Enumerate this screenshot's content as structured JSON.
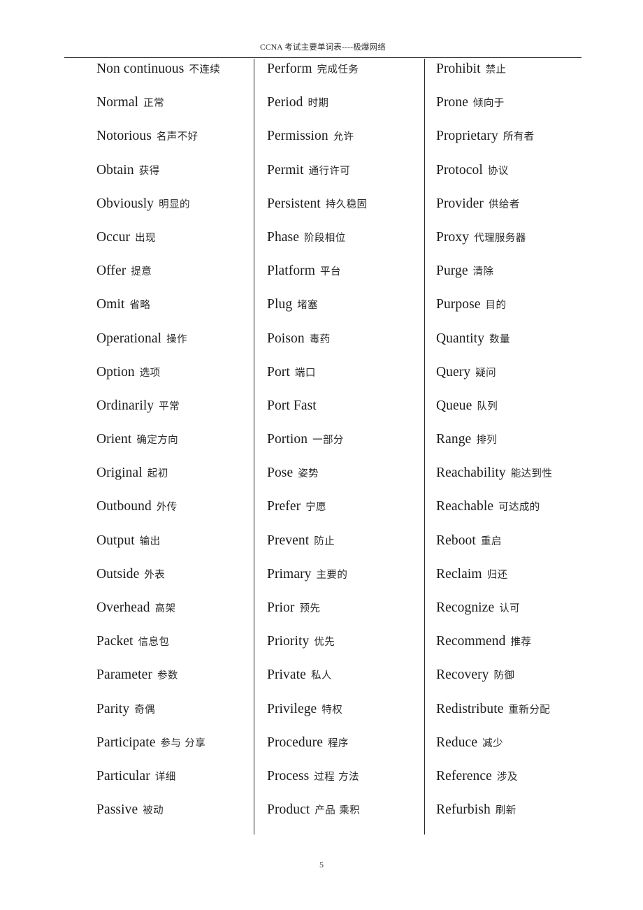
{
  "header": {
    "running_title": "CCNA 考试主要单词表----极爆网络"
  },
  "footer": {
    "page_number": "5"
  },
  "columns": [
    {
      "entries": [
        {
          "term": "Non continuous",
          "gloss": "不连续"
        },
        {
          "term": "Normal",
          "gloss": "正常"
        },
        {
          "term": "Notorious",
          "gloss": "名声不好"
        },
        {
          "term": "Obtain",
          "gloss": "获得"
        },
        {
          "term": "Obviously",
          "gloss": "明显的"
        },
        {
          "term": "Occur",
          "gloss": "出现"
        },
        {
          "term": "Offer",
          "gloss": "提意"
        },
        {
          "term": "Omit",
          "gloss": "省略"
        },
        {
          "term": "Operational",
          "gloss": "操作"
        },
        {
          "term": "Option",
          "gloss": "选项"
        },
        {
          "term": "Ordinarily",
          "gloss": "平常"
        },
        {
          "term": "Orient",
          "gloss": "确定方向"
        },
        {
          "term": "Original",
          "gloss": "起初"
        },
        {
          "term": "Outbound",
          "gloss": "外传"
        },
        {
          "term": "Output",
          "gloss": "输出"
        },
        {
          "term": "Outside",
          "gloss": "外表"
        },
        {
          "term": "Overhead",
          "gloss": "高架"
        },
        {
          "term": "Packet",
          "gloss": "信息包"
        },
        {
          "term": "Parameter",
          "gloss": "参数"
        },
        {
          "term": "Parity",
          "gloss": "奇偶"
        },
        {
          "term": "Participate",
          "gloss": "参与 分享"
        },
        {
          "term": "Particular",
          "gloss": "详细"
        },
        {
          "term": "Passive",
          "gloss": "被动"
        }
      ]
    },
    {
      "entries": [
        {
          "term": "Perform",
          "gloss": "完成任务"
        },
        {
          "term": "Period",
          "gloss": "时期"
        },
        {
          "term": "Permission",
          "gloss": "允许"
        },
        {
          "term": "Permit",
          "gloss": "通行许可"
        },
        {
          "term": "Persistent",
          "gloss": "持久稳固"
        },
        {
          "term": "Phase",
          "gloss": "阶段相位"
        },
        {
          "term": "Platform",
          "gloss": "平台"
        },
        {
          "term": "Plug",
          "gloss": "堵塞"
        },
        {
          "term": "Poison",
          "gloss": "毒药"
        },
        {
          "term": "Port",
          "gloss": "端口"
        },
        {
          "term": "Port Fast",
          "gloss": ""
        },
        {
          "term": "Portion",
          "gloss": "一部分"
        },
        {
          "term": "Pose",
          "gloss": "姿势"
        },
        {
          "term": "Prefer",
          "gloss": "宁愿"
        },
        {
          "term": "Prevent",
          "gloss": "防止"
        },
        {
          "term": "Primary",
          "gloss": "主要的"
        },
        {
          "term": "Prior",
          "gloss": "预先"
        },
        {
          "term": "Priority",
          "gloss": "优先"
        },
        {
          "term": "Private",
          "gloss": "私人"
        },
        {
          "term": "Privilege",
          "gloss": "特权"
        },
        {
          "term": "Procedure",
          "gloss": "程序"
        },
        {
          "term": "Process",
          "gloss": "过程 方法"
        },
        {
          "term": "Product",
          "gloss": "产品 乘积"
        }
      ]
    },
    {
      "entries": [
        {
          "term": "Prohibit",
          "gloss": "禁止"
        },
        {
          "term": "Prone",
          "gloss": "倾向于"
        },
        {
          "term": "Proprietary",
          "gloss": "所有者"
        },
        {
          "term": "Protocol",
          "gloss": "协议"
        },
        {
          "term": "Provider",
          "gloss": "供给者"
        },
        {
          "term": "Proxy",
          "gloss": "代理服务器"
        },
        {
          "term": "Purge",
          "gloss": "清除"
        },
        {
          "term": "Purpose",
          "gloss": "目的"
        },
        {
          "term": "Quantity",
          "gloss": "数量"
        },
        {
          "term": "Query",
          "gloss": "疑问"
        },
        {
          "term": "Queue",
          "gloss": "队列"
        },
        {
          "term": "Range",
          "gloss": "排列"
        },
        {
          "term": "Reachability",
          "gloss": "能达到性"
        },
        {
          "term": "Reachable",
          "gloss": "可达成的"
        },
        {
          "term": "Reboot",
          "gloss": "重启"
        },
        {
          "term": "Reclaim",
          "gloss": "归还"
        },
        {
          "term": "Recognize",
          "gloss": "认可"
        },
        {
          "term": "Recommend",
          "gloss": "推荐"
        },
        {
          "term": "Recovery",
          "gloss": "防御"
        },
        {
          "term": "Redistribute",
          "gloss": "重新分配"
        },
        {
          "term": "Reduce",
          "gloss": "减少"
        },
        {
          "term": "Reference",
          "gloss": "涉及"
        },
        {
          "term": "Refurbish",
          "gloss": "刷新"
        }
      ]
    }
  ]
}
